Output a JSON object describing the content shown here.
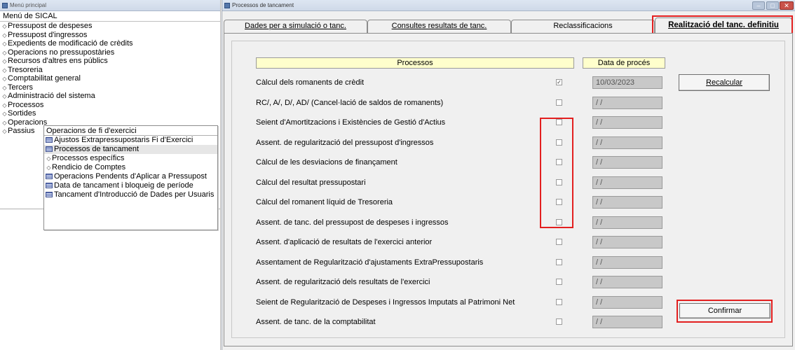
{
  "left_window": {
    "title": "Menú principal",
    "menu_title": "Menú de SICAL",
    "items": [
      "Pressupost de despeses",
      "Pressupost d'ingressos",
      "Expedients de modificació de crèdits",
      "Operacions no pressupostàries",
      "Recursos d'altres ens públics",
      "Tresoreria",
      "Comptabilitat general",
      "Tercers",
      "Administració del sistema",
      "Processos",
      "Sortides",
      "Operacions",
      "Passius"
    ]
  },
  "submenu": {
    "title": "Operacions de fi d'exercici",
    "items": [
      {
        "label": "Ajustos Extrapressupostaris Fi d'Exercici",
        "icon": "grid-icon"
      },
      {
        "label": "Processos de tancament",
        "icon": "grid-icon",
        "selected": true
      },
      {
        "label": "Processos específics",
        "icon": "diamond-icon"
      },
      {
        "label": "Rendicio de Comptes",
        "icon": "diamond-icon"
      },
      {
        "label": "Operacions Pendents d'Aplicar a Pressupost",
        "icon": "grid-icon"
      },
      {
        "label": "Data de tancament i bloqueig de període",
        "icon": "grid-icon"
      },
      {
        "label": "Tancament d'Introducció de Dades per Usuaris",
        "icon": "grid-icon"
      }
    ]
  },
  "right_window": {
    "title": "Processos de tancament",
    "tabs": [
      {
        "label": "Dades per a simulació o tanc."
      },
      {
        "label": "Consultes resultats de tanc."
      },
      {
        "label": "Reclassificacions"
      },
      {
        "label": "Realització del tanc. definitiu",
        "active": true
      }
    ],
    "headers": {
      "processes": "Processos",
      "date": "Data de procés"
    },
    "rows": [
      {
        "label": "Càlcul dels romanents de crèdit",
        "checked": true,
        "date": "10/03/2023"
      },
      {
        "label": "RC/, A/, D/, AD/ (Cancel·lació de saldos de romanents)",
        "checked": false,
        "date": "/ /"
      },
      {
        "label": "Seient d'Amortitzacions i Existències de Gestió d'Actius",
        "checked": false,
        "date": "/ /"
      },
      {
        "label": "Assent. de regularització del pressupost d'ingressos",
        "checked": false,
        "date": "/ /"
      },
      {
        "label": "Càlcul de les desviacions de finançament",
        "checked": false,
        "date": "/ /"
      },
      {
        "label": "Càlcul del resultat pressupostari",
        "checked": false,
        "date": "/ /"
      },
      {
        "label": "Càlcul del romanent líquid de Tresoreria",
        "checked": false,
        "date": "/ /"
      },
      {
        "label": "Assent. de tanc. del pressupost de despeses i ingressos",
        "checked": false,
        "date": "/ /"
      },
      {
        "label": "Assent. d'aplicació de resultats de l'exercici anterior",
        "checked": false,
        "date": "/ /"
      },
      {
        "label": "Assentament de Regularització d'ajustaments ExtraPressupostaris",
        "checked": false,
        "date": "/ /"
      },
      {
        "label": "Assent. de regularització dels resultats de l'exercici",
        "checked": false,
        "date": "/ /"
      },
      {
        "label": "Seient de Regularització de Despeses i Ingressos Imputats al Patrimoni Net",
        "checked": false,
        "date": "/ /"
      },
      {
        "label": "Assent. de tanc. de la comptabilitat",
        "checked": false,
        "date": "/ /"
      }
    ],
    "buttons": {
      "recalc": "Recalcular",
      "confirm": "Confirmar"
    },
    "highlight_color": "#e31f1f"
  }
}
